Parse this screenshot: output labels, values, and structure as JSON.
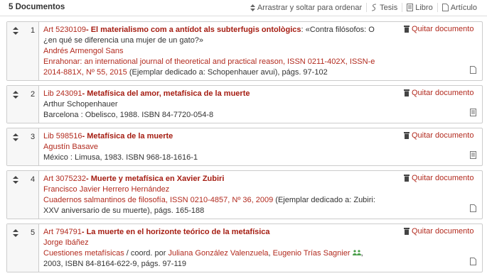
{
  "header": {
    "count": "5 Documentos",
    "sort_label": "Arrastrar y soltar para ordenar",
    "filters": [
      "Tesis",
      "Libro",
      "Artículo"
    ]
  },
  "remove_label": "Quitar documento",
  "items": [
    {
      "num": "1",
      "type": "Art",
      "id": "5230109",
      "title": "El materialismo com a antídot als subterfugis ontològics",
      "subtitle_parts": [
        ": «Contra filósofos: O ¿en qué se diferencia una mujer de un gato?»"
      ],
      "author": "Andrés Armengol Sans",
      "source_link": "Enrahonar: an international journal of theoretical and practical reason",
      "source_rest": ", ISSN 0211-402X, ISSN-e 2014-881X, ",
      "issue": "Nº 55, 2015",
      "source_tail": " (Ejemplar dedicado a: Schopenhauer avui), págs. 97-102"
    },
    {
      "num": "2",
      "type": "Lib",
      "id": "243091",
      "title": "Metafísica del amor, metafísica de la muerte",
      "author": "Arthur Schopenhauer",
      "pub": "Barcelona : Obelisco, 1988. ISBN 84-7720-054-8"
    },
    {
      "num": "3",
      "type": "Lib",
      "id": "598516",
      "title": "Metafísica de la muerte",
      "author": "Agustín Basave",
      "pub": "México : Limusa, 1983. ISBN 968-18-1616-1"
    },
    {
      "num": "4",
      "type": "Art",
      "id": "3075232",
      "title": "Muerte y metafísica en Xavier Zubiri",
      "author": "Francisco Javier Herrero Hernández",
      "source_link": "Cuadernos salmantinos de filosofía",
      "source_rest": ", ISSN 0210-4857, ",
      "issue": "Nº 36, 2009",
      "source_tail": " (Ejemplar dedicado a: Zubiri: XXV aniversario de su muerte), págs. 165-188"
    },
    {
      "num": "5",
      "type": "Art",
      "id": "794791",
      "title": "La muerte en el horizonte teórico de la metafísica",
      "author": "Jorge Ibáñez",
      "source_link": "Cuestiones metafísicas",
      "coord_prefix": " / coord. por ",
      "coord_1": "Juliana González Valenzuela",
      "coord_sep": ", ",
      "coord_2": "Eugenio Trías Sagnier",
      "source_tail": ", 2003, ISBN 84-8164-622-9, págs. 97-119"
    }
  ]
}
